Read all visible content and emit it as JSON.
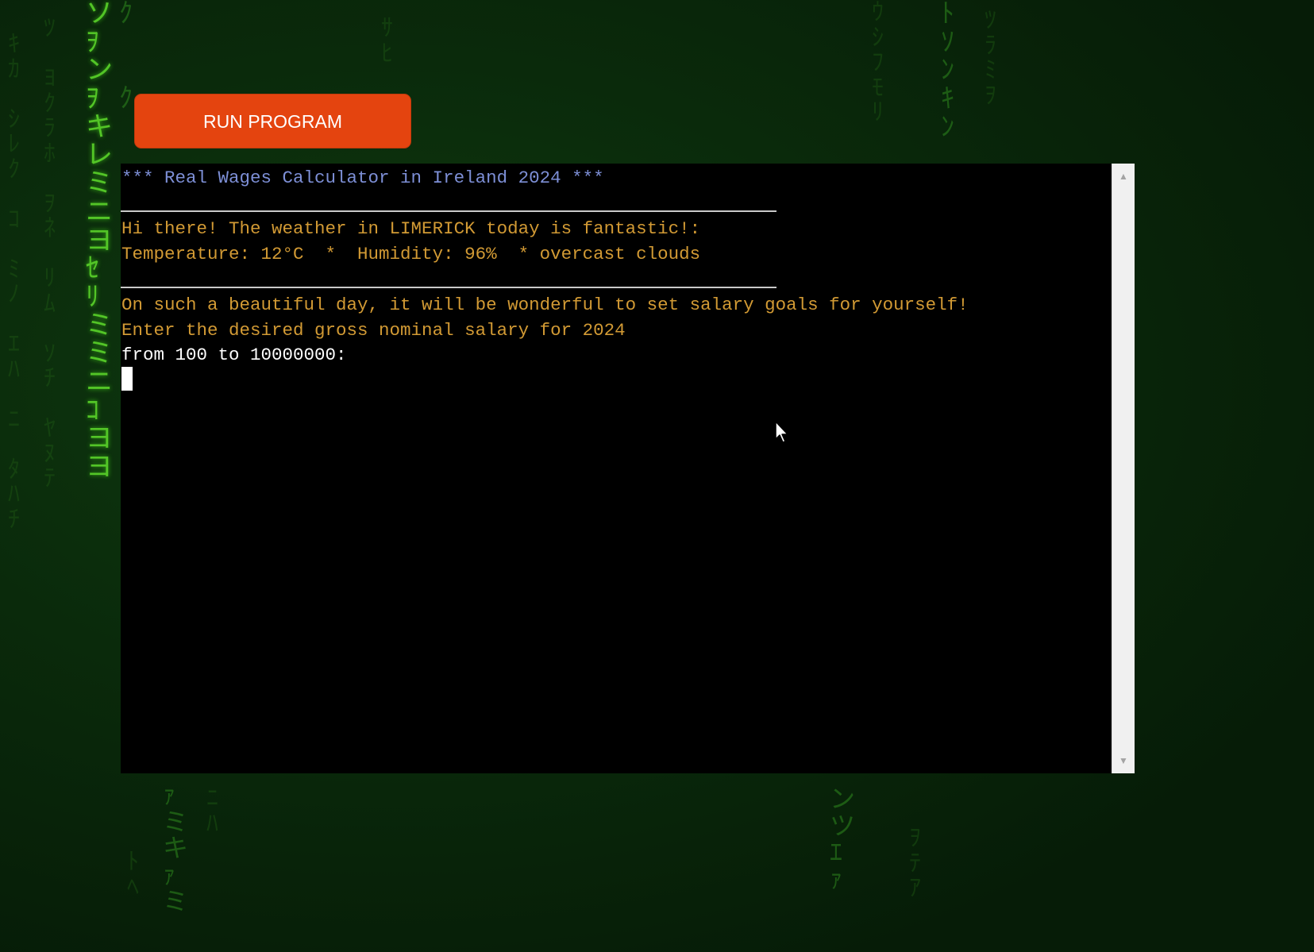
{
  "run_button": {
    "label": "RUN PROGRAM"
  },
  "terminal": {
    "title_line": "*** Real Wages Calculator in Ireland 2024 ***",
    "weather_greeting": "Hi there! The weather in LIMERICK today is fantastic!:",
    "weather_details": "Temperature: 12°C  *  Humidity: 96%  * overcast clouds",
    "goal_message": "On such a beautiful day, it will be wonderful to set salary goals for yourself!",
    "prompt_line": "Enter the desired gross nominal salary for 2024",
    "range_line": "from 100 to 10000000:",
    "input_value": ""
  },
  "colors": {
    "button": "#e4440f",
    "title_text": "#7d8fd6",
    "message_text": "#d29a34",
    "input_text": "#ffffff",
    "terminal_bg": "#000000"
  }
}
